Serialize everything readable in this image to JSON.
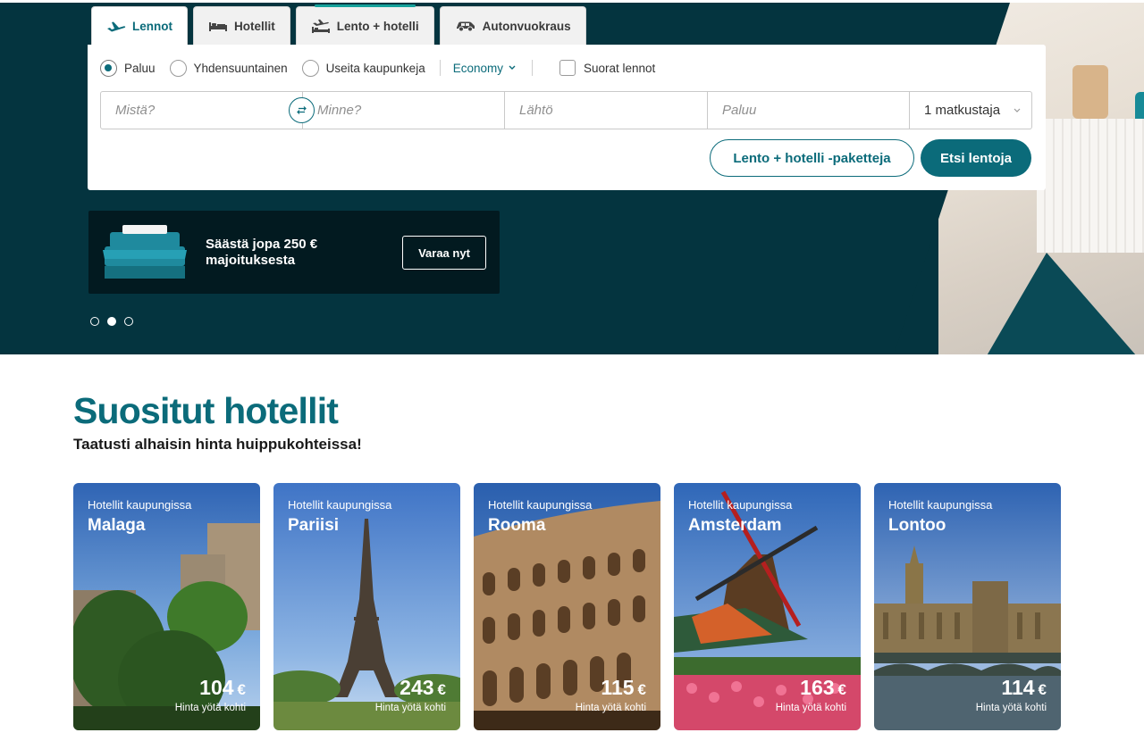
{
  "tabs": [
    {
      "label": "Lennot",
      "icon": "plane-icon",
      "active": true
    },
    {
      "label": "Hotellit",
      "icon": "bed-icon",
      "active": false
    },
    {
      "label": "Lento + hotelli",
      "icon": "plane-hotel-icon",
      "active": false
    },
    {
      "label": "Autonvuokraus",
      "icon": "car-icon",
      "active": false
    }
  ],
  "trip_options": {
    "return": "Paluu",
    "one_way": "Yhdensuuntainen",
    "multi_city": "Useita kaupunkeja",
    "selected": "return",
    "cabin_class": "Economy",
    "direct_only_label": "Suorat lennot",
    "direct_only_checked": false
  },
  "fields": {
    "from_placeholder": "Mistä?",
    "to_placeholder": "Minne?",
    "departure_placeholder": "Lähtö",
    "return_placeholder": "Paluu",
    "passengers": "1 matkustaja"
  },
  "buttons": {
    "packages": "Lento + hotelli -paketteja",
    "search": "Etsi lentoja"
  },
  "promo": {
    "text": "Säästä jopa 250 € majoituksesta",
    "button": "Varaa nyt"
  },
  "carousel": {
    "count": 3,
    "active_index": 1
  },
  "section": {
    "title": "Suositut hotellit",
    "subtitle": "Taatusti alhaisin hinta huippukohteissa!"
  },
  "hotel_cards": [
    {
      "caption": "Hotellit kaupungissa",
      "city": "Malaga",
      "price": "104",
      "currency": "€",
      "per_night": "Hinta yötä kohti"
    },
    {
      "caption": "Hotellit kaupungissa",
      "city": "Pariisi",
      "price": "243",
      "currency": "€",
      "per_night": "Hinta yötä kohti"
    },
    {
      "caption": "Hotellit kaupungissa",
      "city": "Rooma",
      "price": "115",
      "currency": "€",
      "per_night": "Hinta yötä kohti"
    },
    {
      "caption": "Hotellit kaupungissa",
      "city": "Amsterdam",
      "price": "163",
      "currency": "€",
      "per_night": "Hinta yötä kohti"
    },
    {
      "caption": "Hotellit kaupungissa",
      "city": "Lontoo",
      "price": "114",
      "currency": "€",
      "per_night": "Hinta yötä kohti"
    }
  ],
  "colors": {
    "brand": "#0b6b7a",
    "hero_bg": "#04343f",
    "promo_bg": "#021a20"
  }
}
